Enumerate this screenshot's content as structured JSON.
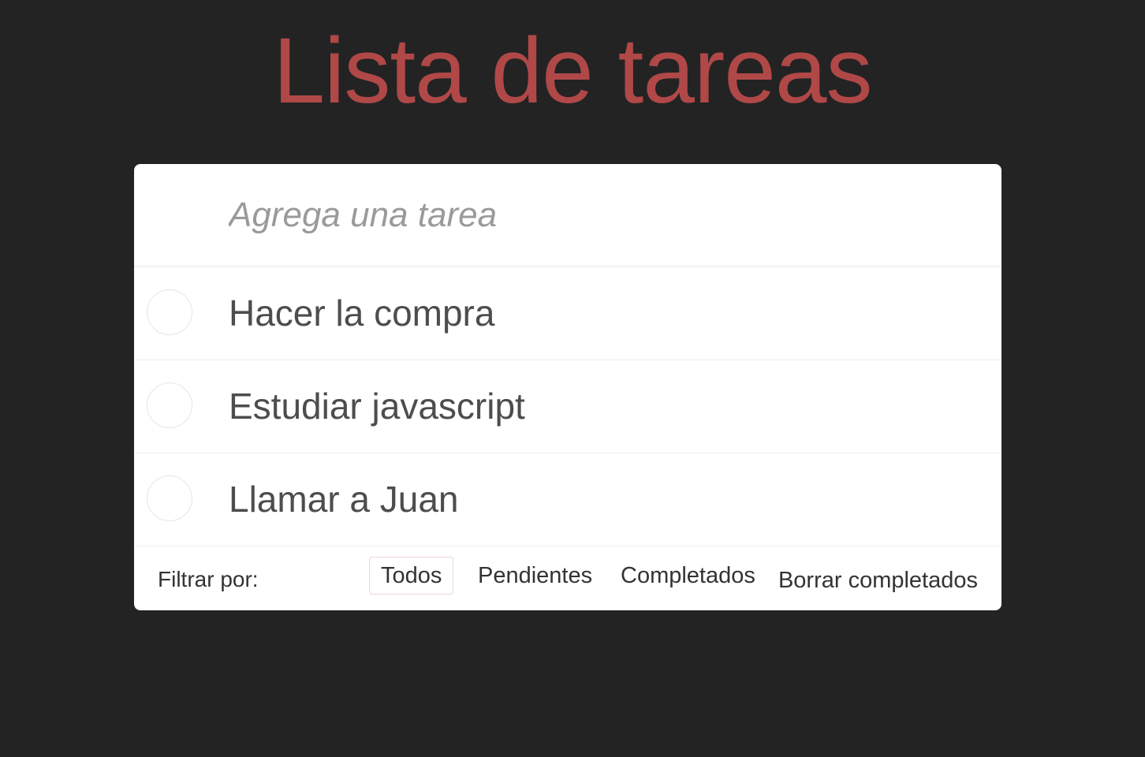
{
  "header": {
    "title": "Lista de tareas"
  },
  "colors": {
    "background": "#232323",
    "title": "#b04848",
    "card": "#ffffff",
    "todo_text": "#4d4d4d",
    "placeholder": "#9a9a9a",
    "selected_filter_border": "#efd5d5"
  },
  "new_todo": {
    "placeholder": "Agrega una tarea",
    "value": ""
  },
  "todos": [
    {
      "label": "Hacer la compra",
      "completed": false
    },
    {
      "label": "Estudiar javascript",
      "completed": false
    },
    {
      "label": "Llamar a Juan",
      "completed": false
    }
  ],
  "footer": {
    "filter_label": "Filtrar por:",
    "filters": [
      {
        "label": "Todos",
        "selected": true
      },
      {
        "label": "Pendientes",
        "selected": false
      },
      {
        "label": "Completados",
        "selected": false
      }
    ],
    "clear_label": "Borrar completados"
  }
}
